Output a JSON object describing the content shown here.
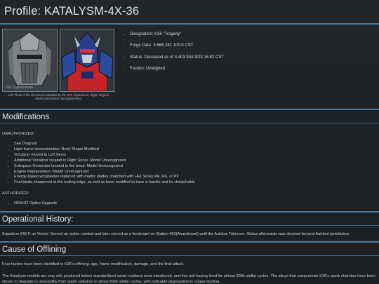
{
  "header": {
    "title": "Profile: KATALYSM-4X-36"
  },
  "images": {
    "left_watermark": "TEL Cybertronian",
    "caption": "Left: Photo of the deceased submitted by the SPC department. Right: Original Model colorization and appearance"
  },
  "facts": [
    "Designation: K36 \"Tragedy\"",
    "Forge Date: 3.668.281 10/10 CST",
    "Status: Deceased as of 4.403.944 9/23 16:82 CST",
    "Faction: Unaligned"
  ],
  "modifications": {
    "heading": "Modifications",
    "unauthorized_label": "UNAUTHORIZED:",
    "unauthorized": [
      "See Diagram",
      "Light frame reconstruction: Body Shape Modified",
      "Vocalizer moved to Left Servo",
      "Additional Vocalizer located in Right Servo: Model Unrecognized",
      "Subspace Generator located in the head: Model Unrecognized",
      "Engine Replacement: Model Unrecognized",
      "Energy-based wingblades replaced with matter blades; matched with HEI Series PA, RA, or P2",
      "First blade sharpened at the trailing edge, as well as base modified to have a handle and be detatchable"
    ],
    "authorized_label": "AUTHORIZED:",
    "authorized": [
      "OEM:02 Optics Upgrade"
    ]
  },
  "history": {
    "heading": "Operational History:",
    "text": "Squadron 642-F on Vector: Served an active combat and later served as a lieutenant on Station 462(Abandoned) until the Autobot Takeover. Status afterwards was deemed beyond Autobot jurisdiction."
  },
  "offlining": {
    "heading": "Cause of Offlining",
    "intro": "Four factors have been identified in K36's offlining: age, frame modification, damage, and the final attack.",
    "detail": "The Katalysm models are very old, produced before standardized serial numbers were introduced, and this unit having lived for almost 800k stellar cycles. The alloys that compromise K36's spark chamber have been shown to degrade to unusability from spark radiation in about 956k stellar cycles, with noticable degregation in output starting"
  },
  "colors": {
    "accent": "#4a7d9b",
    "background": "#1b1e21",
    "text": "#c9d0d6"
  }
}
